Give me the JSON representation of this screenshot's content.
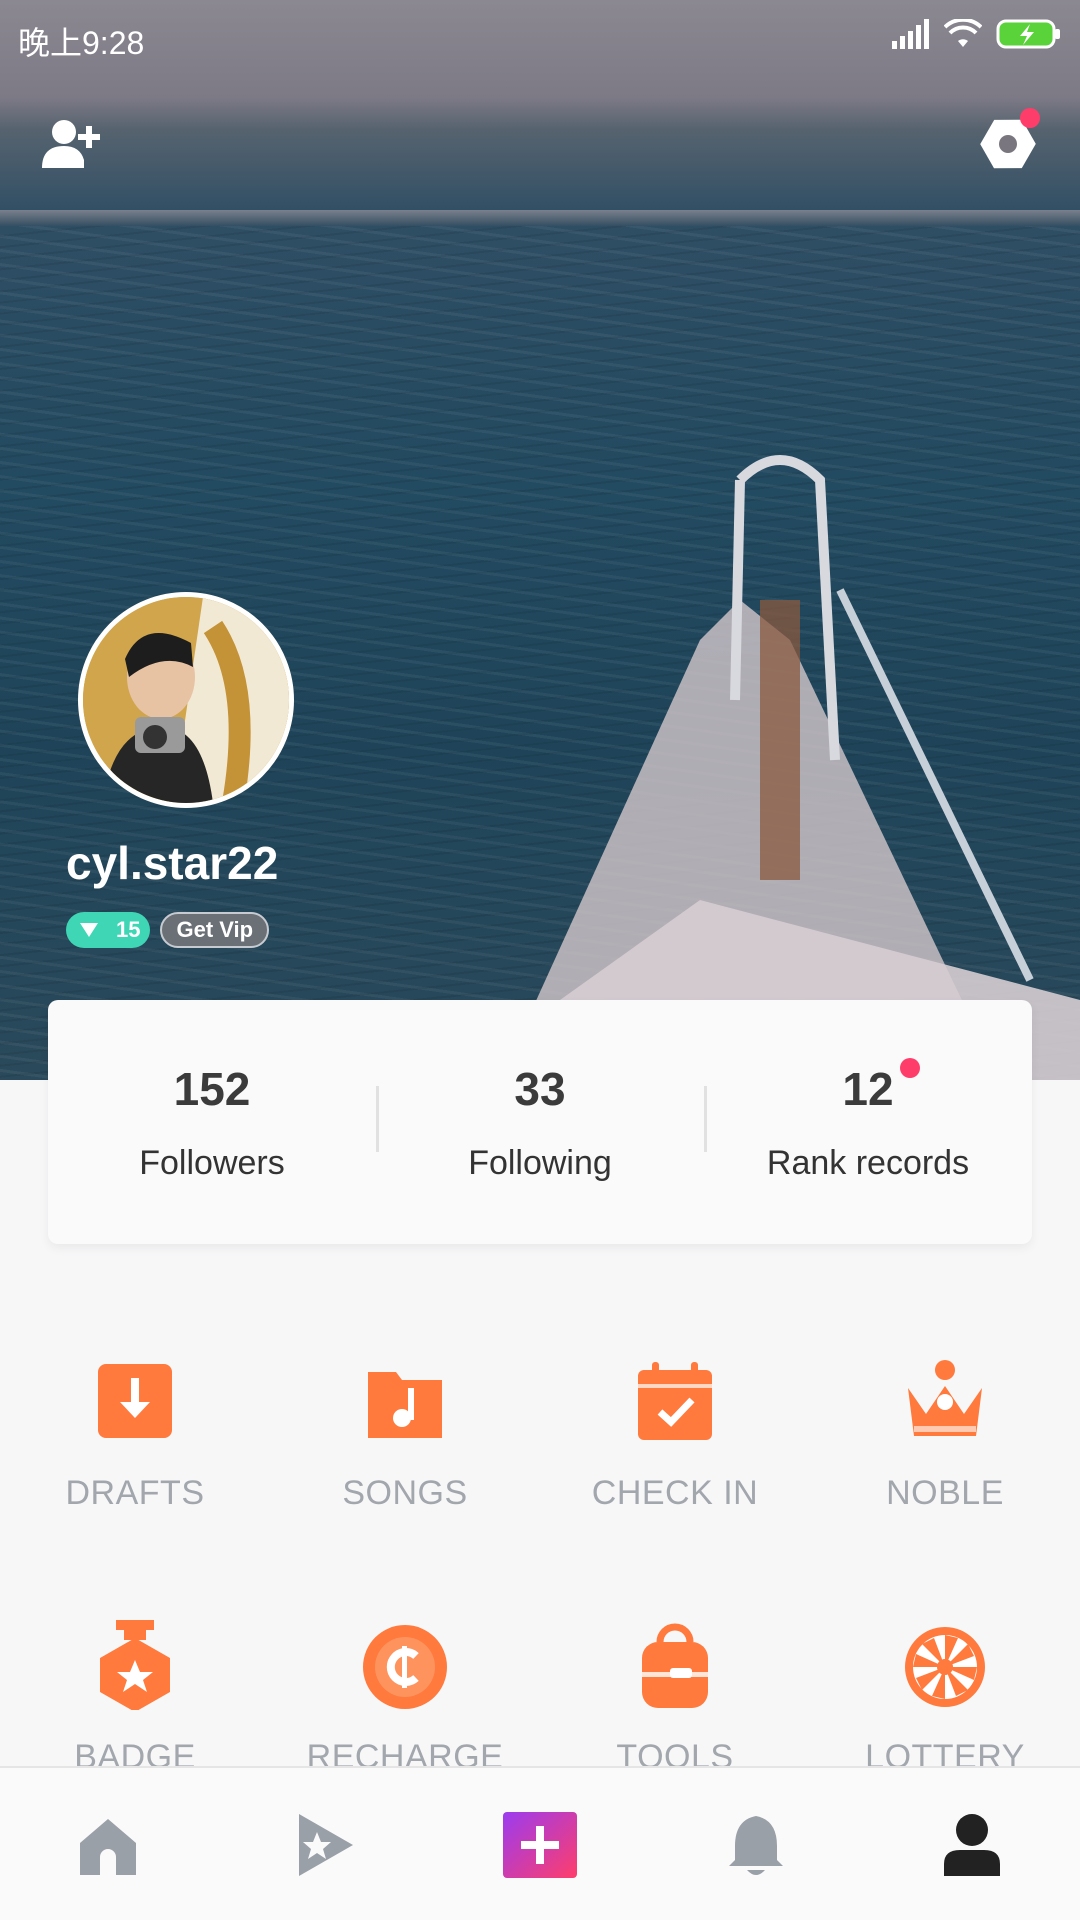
{
  "status_bar": {
    "time": "晚上9:28"
  },
  "profile": {
    "username": "cyl.star22",
    "level": "15",
    "vip_label": "Get Vip"
  },
  "stats": [
    {
      "value": "152",
      "label": "Followers"
    },
    {
      "value": "33",
      "label": "Following"
    },
    {
      "value": "12",
      "label": "Rank records"
    }
  ],
  "grid": {
    "row1": [
      {
        "label": "DRAFTS",
        "icon": "download-icon"
      },
      {
        "label": "SONGS",
        "icon": "music-folder-icon"
      },
      {
        "label": "CHECK IN",
        "icon": "calendar-check-icon"
      },
      {
        "label": "NOBLE",
        "icon": "crown-icon"
      }
    ],
    "row2": [
      {
        "label": "BADGE",
        "icon": "badge-icon"
      },
      {
        "label": "RECHARGE",
        "icon": "coin-icon"
      },
      {
        "label": "TOOLS",
        "icon": "backpack-icon"
      },
      {
        "label": "LOTTERY",
        "icon": "wheel-icon"
      }
    ]
  },
  "bottom_nav": [
    "home-icon",
    "star-play-icon",
    "create-plus-icon",
    "bell-icon",
    "profile-icon"
  ],
  "colors": {
    "accent": "#ff7a3c",
    "label_gray": "#a2a6ad",
    "dot_red": "#ff3d6b",
    "level_teal": "#3ed6b5"
  }
}
